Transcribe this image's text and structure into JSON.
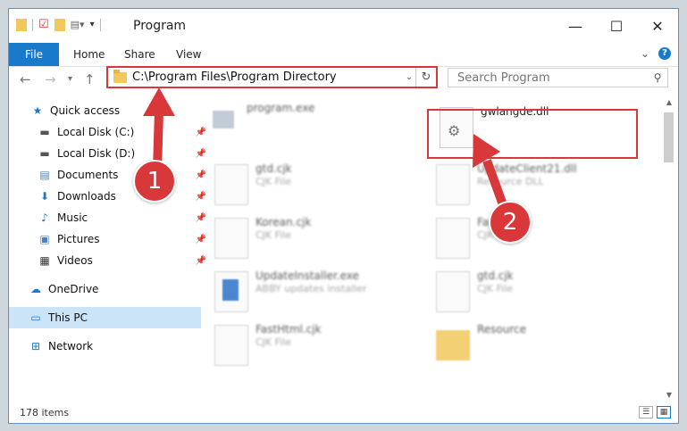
{
  "window": {
    "title": "Program",
    "controls": {
      "minimize": "—",
      "maximize": "☐",
      "close": "✕"
    }
  },
  "ribbon": {
    "tabs": [
      "File",
      "Home",
      "Share",
      "View"
    ]
  },
  "nav": {
    "address": "C:\\Program Files\\Program Directory",
    "search_placeholder": "Search Program"
  },
  "sidebar": {
    "items": [
      {
        "label": "Quick access",
        "icon": "star-icon",
        "pinned": false
      },
      {
        "label": "Local Disk (C:)",
        "icon": "drive-icon",
        "pinned": true
      },
      {
        "label": "Local Disk (D:)",
        "icon": "drive-icon",
        "pinned": true
      },
      {
        "label": "Documents",
        "icon": "documents-icon",
        "pinned": true
      },
      {
        "label": "Downloads",
        "icon": "download-icon",
        "pinned": true
      },
      {
        "label": "Music",
        "icon": "music-icon",
        "pinned": true
      },
      {
        "label": "Pictures",
        "icon": "pictures-icon",
        "pinned": true
      },
      {
        "label": "Videos",
        "icon": "videos-icon",
        "pinned": true
      },
      {
        "label": "OneDrive",
        "icon": "cloud-icon",
        "pinned": false
      },
      {
        "label": "This PC",
        "icon": "computer-icon",
        "pinned": false
      },
      {
        "label": "Network",
        "icon": "network-icon",
        "pinned": false
      }
    ]
  },
  "files": [
    {
      "name": "program.exe",
      "type": ""
    },
    {
      "name": "gwlangde.dll",
      "type": ""
    },
    {
      "name": "gtd.cjk",
      "type": "CJK File"
    },
    {
      "name": "UpdateClient21.dll",
      "type": "Resource DLL"
    },
    {
      "name": "Korean.cjk",
      "type": "CJK File"
    },
    {
      "name": "Fast...cjk",
      "type": "CJK File"
    },
    {
      "name": "UpdateInstaller.exe",
      "type": "ABBY updates installer"
    },
    {
      "name": "gtd.cjk",
      "type": "CJK File"
    },
    {
      "name": "FastHtml.cjk",
      "type": "CJK File"
    },
    {
      "name": "Resource",
      "type": ""
    }
  ],
  "status": {
    "count": "178 items"
  },
  "badges": {
    "one": "1",
    "two": "2"
  },
  "colors": {
    "accent": "#1979ca",
    "highlight": "#d9383a"
  }
}
